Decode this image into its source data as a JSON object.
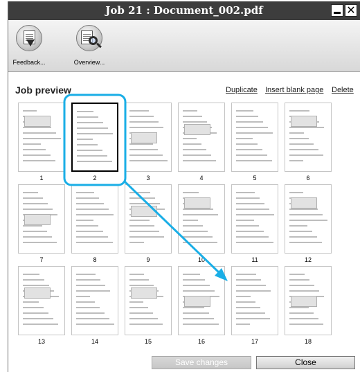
{
  "window": {
    "title": "Job 21 : Document_002.pdf"
  },
  "toolbar": {
    "items": [
      {
        "label": "Feedback...",
        "icon": "feedback-icon"
      },
      {
        "label": "Overview...",
        "icon": "overview-icon"
      }
    ]
  },
  "preview": {
    "heading": "Job preview",
    "actions": {
      "duplicate": "Duplicate",
      "insert_blank": "Insert blank page",
      "delete": "Delete"
    },
    "selected_page": 2,
    "pages": [
      "1",
      "2",
      "3",
      "4",
      "5",
      "6",
      "7",
      "8",
      "9",
      "10",
      "11",
      "12",
      "13",
      "14",
      "15",
      "16",
      "17",
      "18"
    ]
  },
  "footer": {
    "save_label": "Save changes",
    "close_label": "Close"
  },
  "colors": {
    "highlight": "#1aaee6",
    "titlebar": "#3d3d3d"
  }
}
